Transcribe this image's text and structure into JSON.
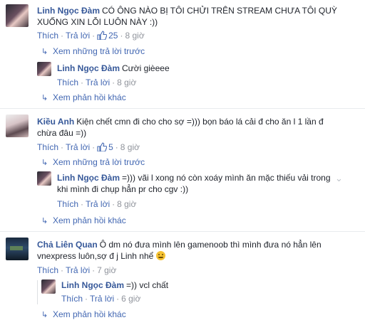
{
  "threads": [
    {
      "author": "Linh Ngọc Đàm",
      "text": "CÓ ÔNG NÀO BỊ TÔI CHỬI TRÊN STREAM CHƯA TÔI QUỲ XUỐNG XIN LỖI LUÔN NÀY :))",
      "like_label": "Thích",
      "reply_label": "Trả lời",
      "likes": "25",
      "time": "8 giờ",
      "previous_replies_label": "Xem những trả lời trước",
      "reply": {
        "author": "Linh Ngọc Đàm",
        "text": "Cười gièeee",
        "like_label": "Thích",
        "reply_label": "Trả lời",
        "time": "8 giờ"
      },
      "more_label": "Xem phản hồi khác"
    },
    {
      "author": "Kiều Anh",
      "text": "Kiện chết cmn đi cho cho sợ =))) bọn báo lá cải đ cho ăn l 1 lần đ chừa đâu =))",
      "like_label": "Thích",
      "reply_label": "Trả lời",
      "likes": "5",
      "time": "8 giờ",
      "previous_replies_label": "Xem những trả lời trước",
      "reply": {
        "author": "Linh Ngọc Đàm",
        "text": "=))) vãi l xong nó còn xoáy mình ăn mặc thiếu vải trong khi mình đi chụp hẳn pr cho cgv :))",
        "like_label": "Thích",
        "reply_label": "Trả lời",
        "time": "8 giờ"
      },
      "more_label": "Xem phản hồi khác"
    },
    {
      "author": "Chả Liên Quan",
      "text": "Ô dm nó đưa mình lên gamenoob thì mình đưa nó hẳn lên vnexpress luôn,sợ đ j Linh nhể",
      "like_label": "Thích",
      "reply_label": "Trả lời",
      "time": "7 giờ",
      "reply": {
        "author": "Linh Ngọc Đàm",
        "text": "=)) vcl chất",
        "like_label": "Thích",
        "reply_label": "Trả lời",
        "time": "6 giờ"
      },
      "more_label": "Xem phản hồi khác"
    }
  ],
  "colors": {
    "author": "#365899",
    "link": "#4267b2",
    "meta": "#90949c",
    "text": "#1d2129"
  }
}
